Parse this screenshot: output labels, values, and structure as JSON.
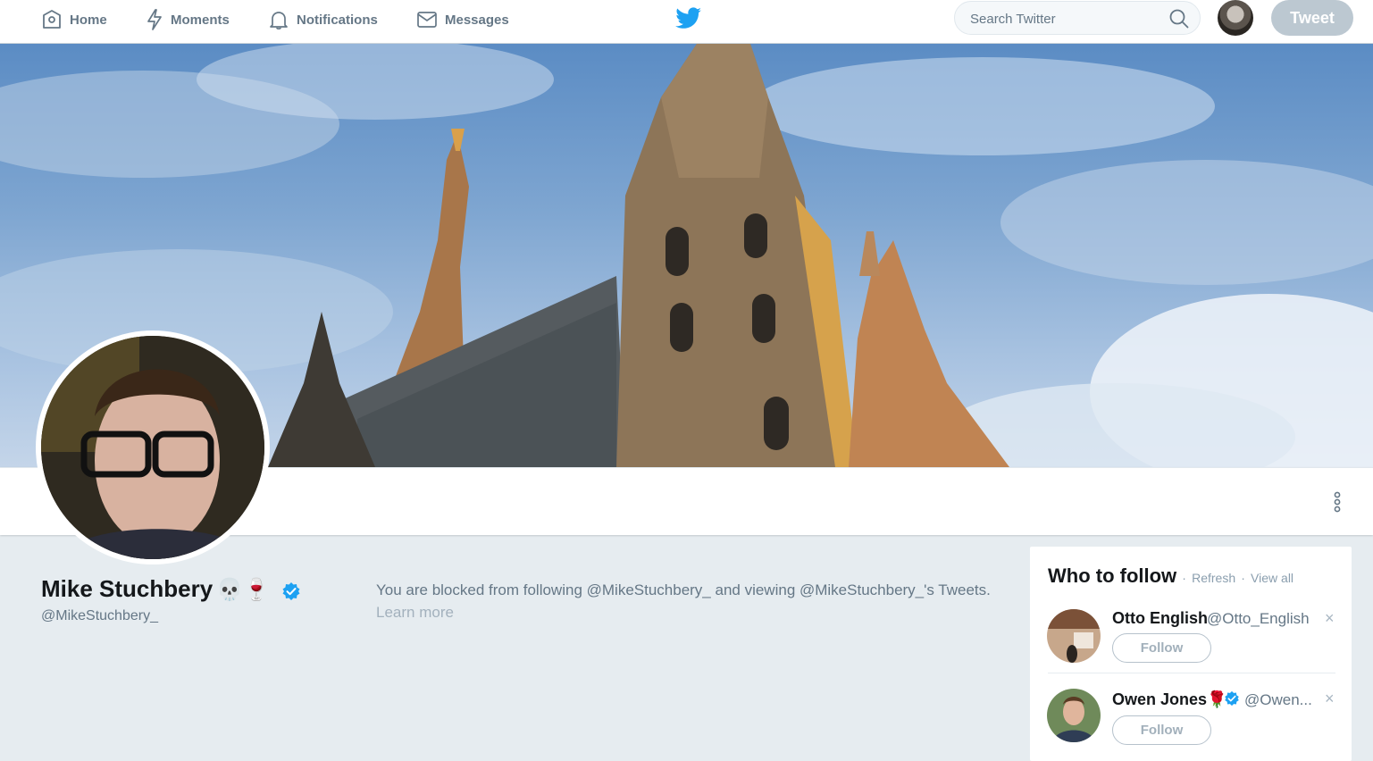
{
  "nav": {
    "items": [
      {
        "label": "Home",
        "icon": "home-icon"
      },
      {
        "label": "Moments",
        "icon": "lightning-icon"
      },
      {
        "label": "Notifications",
        "icon": "bell-icon"
      },
      {
        "label": "Messages",
        "icon": "envelope-icon"
      }
    ],
    "search_placeholder": "Search Twitter",
    "tweet_label": "Tweet"
  },
  "colors": {
    "brand": "#1da1f2",
    "muted": "#657786",
    "background": "#e6ecf0",
    "tweet_button_disabled": "#bcc8d1"
  },
  "profile": {
    "name": "Mike Stuchbery",
    "name_emoji": "💀🍷",
    "verified": true,
    "handle": "@MikeStuchbery_",
    "blocked_message": "You are blocked from following @MikeStuchbery_ and viewing @MikeStuchbery_'s Tweets.",
    "learn_more": "Learn more"
  },
  "who_to_follow": {
    "title": "Who to follow",
    "refresh": "Refresh",
    "view_all": "View all",
    "separator": "·",
    "suggestions": [
      {
        "name": "Otto English",
        "name_suffix": "",
        "verified": false,
        "handle": "@Otto_English",
        "follow_label": "Follow",
        "dismiss": "×"
      },
      {
        "name": "Owen Jones",
        "name_suffix": "🌹",
        "verified": true,
        "handle": "@Owen...",
        "follow_label": "Follow",
        "dismiss": "×"
      }
    ]
  }
}
